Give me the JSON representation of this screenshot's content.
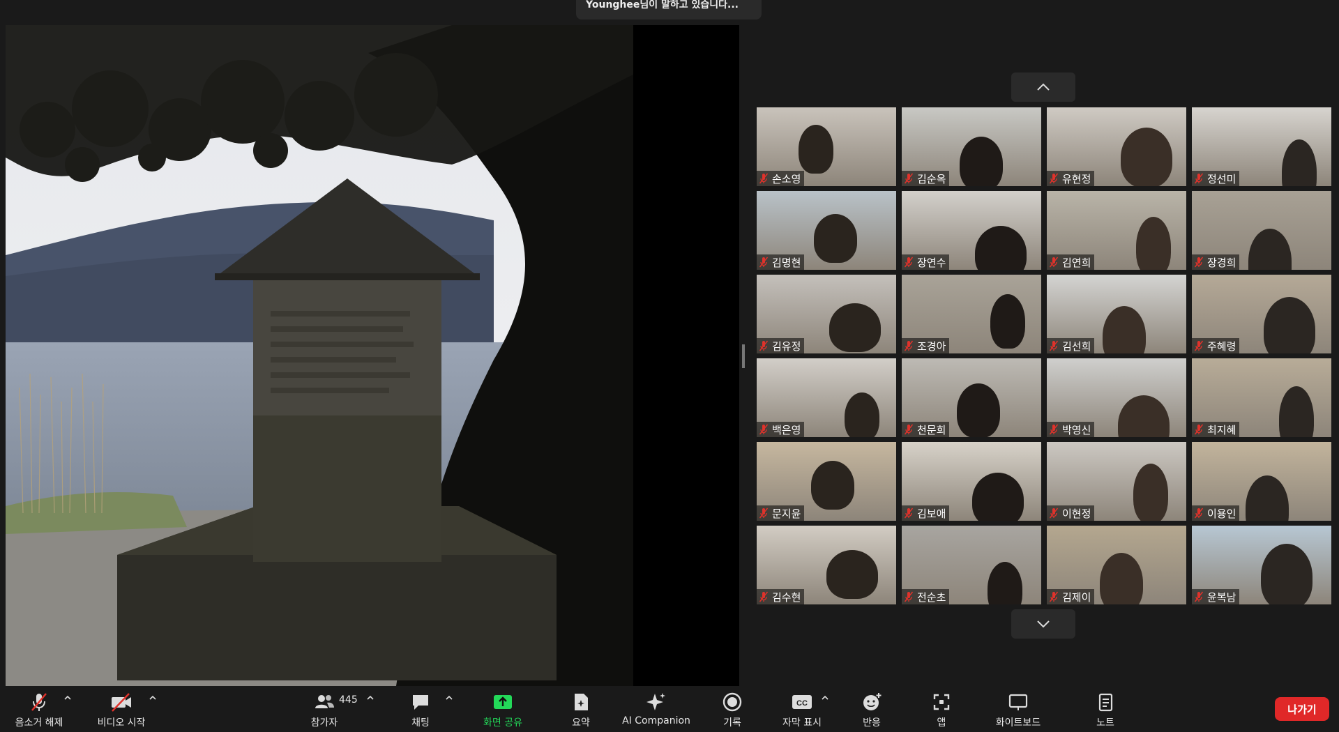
{
  "notification": {
    "text": "Younghee님이 말하고 있습니다..."
  },
  "participants": [
    {
      "name": "손소영",
      "bg": "#c9c3bb"
    },
    {
      "name": "김순옥",
      "bg": "#c8c8c4"
    },
    {
      "name": "유현정",
      "bg": "#cfcac3"
    },
    {
      "name": "정선미",
      "bg": "#d7d4cf"
    },
    {
      "name": "김명현",
      "bg": "#b9c2c8"
    },
    {
      "name": "장연수",
      "bg": "#d3d0cb"
    },
    {
      "name": "김연희",
      "bg": "#b9b4a8"
    },
    {
      "name": "장경희",
      "bg": "#a8a195"
    },
    {
      "name": "김유정",
      "bg": "#c4c0bb"
    },
    {
      "name": "조경아",
      "bg": "#a9a398"
    },
    {
      "name": "김선희",
      "bg": "#d4d4d2"
    },
    {
      "name": "주혜령",
      "bg": "#b5a997"
    },
    {
      "name": "백은영",
      "bg": "#d2cec8"
    },
    {
      "name": "천문희",
      "bg": "#bdbab4"
    },
    {
      "name": "박영신",
      "bg": "#cfcfcd"
    },
    {
      "name": "최지혜",
      "bg": "#b8ac98"
    },
    {
      "name": "문지윤",
      "bg": "#c6b79f"
    },
    {
      "name": "김보애",
      "bg": "#d7d2c9"
    },
    {
      "name": "이현정",
      "bg": "#ccc8c2"
    },
    {
      "name": "이용인",
      "bg": "#c2b49c"
    },
    {
      "name": "김수현",
      "bg": "#d2ccc3"
    },
    {
      "name": "전순초",
      "bg": "#a8a5a0"
    },
    {
      "name": "김제이",
      "bg": "#b4a78f"
    },
    {
      "name": "윤복남",
      "bg": "#b7c7d3"
    }
  ],
  "toolbar": {
    "mute": "음소거 해제",
    "video": "비디오 시작",
    "participants": "참가자",
    "participants_count": "445",
    "chat": "채팅",
    "share": "화면 공유",
    "summary": "요약",
    "ai": "AI Companion",
    "record": "기록",
    "captions": "자막 표시",
    "reactions": "반응",
    "apps": "앱",
    "whiteboard": "화이트보드",
    "notes": "노트",
    "leave": "나가기"
  },
  "colors": {
    "share_green": "#23d959",
    "leave_red": "#e02828",
    "mute_red": "#e0322b"
  }
}
